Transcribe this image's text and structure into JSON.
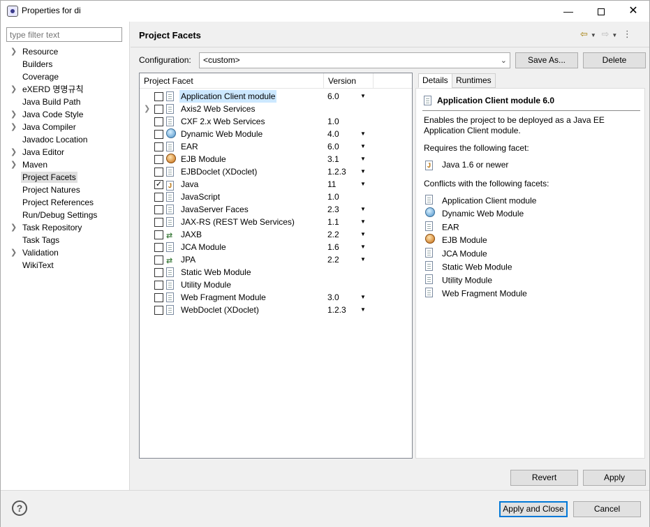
{
  "window": {
    "title": "Properties for di"
  },
  "filter": {
    "placeholder": "type filter text"
  },
  "nav": [
    {
      "label": "Resource",
      "expandable": true
    },
    {
      "label": "Builders",
      "expandable": false
    },
    {
      "label": "Coverage",
      "expandable": false
    },
    {
      "label": "eXERD 명명규칙",
      "expandable": true
    },
    {
      "label": "Java Build Path",
      "expandable": false
    },
    {
      "label": "Java Code Style",
      "expandable": true
    },
    {
      "label": "Java Compiler",
      "expandable": true
    },
    {
      "label": "Javadoc Location",
      "expandable": false
    },
    {
      "label": "Java Editor",
      "expandable": true
    },
    {
      "label": "Maven",
      "expandable": true
    },
    {
      "label": "Project Facets",
      "expandable": false,
      "selected": true
    },
    {
      "label": "Project Natures",
      "expandable": false
    },
    {
      "label": "Project References",
      "expandable": false
    },
    {
      "label": "Run/Debug Settings",
      "expandable": false
    },
    {
      "label": "Task Repository",
      "expandable": true
    },
    {
      "label": "Task Tags",
      "expandable": false
    },
    {
      "label": "Validation",
      "expandable": true
    },
    {
      "label": "WikiText",
      "expandable": false
    }
  ],
  "page": {
    "title": "Project Facets"
  },
  "config": {
    "label": "Configuration:",
    "value": "<custom>",
    "save_as": "Save As...",
    "delete": "Delete"
  },
  "table": {
    "col_facet": "Project Facet",
    "col_version": "Version",
    "rows": [
      {
        "name": "Application Client module",
        "version": "6.0",
        "dropdown": true,
        "checked": false,
        "icon": "document-icon",
        "selected": true
      },
      {
        "name": "Axis2 Web Services",
        "version": "",
        "dropdown": false,
        "checked": false,
        "icon": "document-icon",
        "expandable": true
      },
      {
        "name": "CXF 2.x Web Services",
        "version": "1.0",
        "dropdown": false,
        "checked": false,
        "icon": "document-icon"
      },
      {
        "name": "Dynamic Web Module",
        "version": "4.0",
        "dropdown": true,
        "checked": false,
        "icon": "globe-icon"
      },
      {
        "name": "EAR",
        "version": "6.0",
        "dropdown": true,
        "checked": false,
        "icon": "document-icon"
      },
      {
        "name": "EJB Module",
        "version": "3.1",
        "dropdown": true,
        "checked": false,
        "icon": "ejb-icon"
      },
      {
        "name": "EJBDoclet (XDoclet)",
        "version": "1.2.3",
        "dropdown": true,
        "checked": false,
        "icon": "document-icon"
      },
      {
        "name": "Java",
        "version": "11",
        "dropdown": true,
        "checked": true,
        "icon": "java-icon"
      },
      {
        "name": "JavaScript",
        "version": "1.0",
        "dropdown": false,
        "checked": false,
        "icon": "document-icon"
      },
      {
        "name": "JavaServer Faces",
        "version": "2.3",
        "dropdown": true,
        "checked": false,
        "icon": "document-icon"
      },
      {
        "name": "JAX-RS (REST Web Services)",
        "version": "1.1",
        "dropdown": true,
        "checked": false,
        "icon": "document-icon"
      },
      {
        "name": "JAXB",
        "version": "2.2",
        "dropdown": true,
        "checked": false,
        "icon": "arrows-icon"
      },
      {
        "name": "JCA Module",
        "version": "1.6",
        "dropdown": true,
        "checked": false,
        "icon": "document-icon"
      },
      {
        "name": "JPA",
        "version": "2.2",
        "dropdown": true,
        "checked": false,
        "icon": "arrows-icon"
      },
      {
        "name": "Static Web Module",
        "version": "",
        "dropdown": false,
        "checked": false,
        "icon": "document-icon"
      },
      {
        "name": "Utility Module",
        "version": "",
        "dropdown": false,
        "checked": false,
        "icon": "document-icon"
      },
      {
        "name": "Web Fragment Module",
        "version": "3.0",
        "dropdown": true,
        "checked": false,
        "icon": "document-icon"
      },
      {
        "name": "WebDoclet (XDoclet)",
        "version": "1.2.3",
        "dropdown": true,
        "checked": false,
        "icon": "document-icon"
      }
    ]
  },
  "tabs": {
    "details": "Details",
    "runtimes": "Runtimes"
  },
  "details": {
    "title": "Application Client module 6.0",
    "description": "Enables the project to be deployed as a Java EE Application Client module.",
    "requires_label": "Requires the following facet:",
    "requires": [
      {
        "label": "Java 1.6 or newer",
        "icon": "java-icon"
      }
    ],
    "conflicts_label": "Conflicts with the following facets:",
    "conflicts": [
      {
        "label": "Application Client module",
        "icon": "document-icon"
      },
      {
        "label": "Dynamic Web Module",
        "icon": "globe-icon"
      },
      {
        "label": "EAR",
        "icon": "document-icon"
      },
      {
        "label": "EJB Module",
        "icon": "ejb-icon"
      },
      {
        "label": "JCA Module",
        "icon": "document-icon"
      },
      {
        "label": "Static Web Module",
        "icon": "document-icon"
      },
      {
        "label": "Utility Module",
        "icon": "document-icon"
      },
      {
        "label": "Web Fragment Module",
        "icon": "document-icon"
      }
    ]
  },
  "buttons": {
    "revert": "Revert",
    "apply": "Apply",
    "apply_close": "Apply and Close",
    "cancel": "Cancel"
  }
}
